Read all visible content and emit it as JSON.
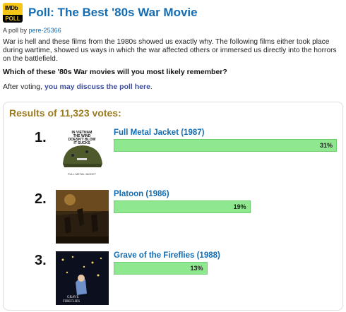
{
  "logo": {
    "top": "IMDb",
    "bottom": "POLL"
  },
  "title": "Poll: The Best '80s War Movie",
  "byline": {
    "prefix": "A poll by",
    "author": "pere-25366"
  },
  "description": "War is hell and these films from the 1980s showed us exactly why. The following films either took place during wartime, showed us ways in which the war affected others or immersed us directly into the horrors on the battlefield.",
  "question": "Which of these '80s War movies will you most likely remember?",
  "after_voting": {
    "prefix": "After voting,",
    "link": "you may discuss the poll here",
    "suffix": "."
  },
  "results": {
    "title": "Results of 11,323 votes:",
    "entries": [
      {
        "rank": "1.",
        "title": "Full Metal Jacket (1987)",
        "percent": 31,
        "percent_label": "31%"
      },
      {
        "rank": "2.",
        "title": "Platoon (1986)",
        "percent": 19,
        "percent_label": "19%"
      },
      {
        "rank": "3.",
        "title": "Grave of the Fireflies (1988)",
        "percent": 13,
        "percent_label": "13%"
      }
    ]
  },
  "posters": {
    "full_metal_jacket_text": [
      "IN VIETNAM",
      "THE WIND",
      "DOESN'T BLOW",
      "IT SUCKS"
    ],
    "full_metal_jacket_caption": "FULL METAL JACKET",
    "grave_caption": [
      "GRAVE",
      "FIREFLIES"
    ]
  },
  "colors": {
    "link": "#136cb2",
    "results_title": "#9a7b1e",
    "bar": "#8fe88f",
    "logo": "#f5c518"
  }
}
